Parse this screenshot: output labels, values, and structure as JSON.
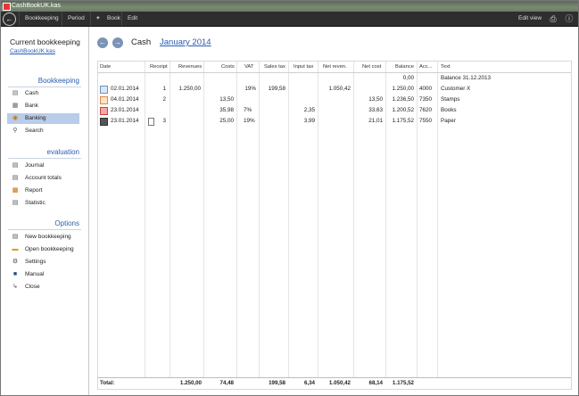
{
  "window": {
    "title": "CashBookUK.kas"
  },
  "toolbar": {
    "items": [
      "Bookkeeping",
      "Period",
      "Book",
      "Edit"
    ],
    "add_glyph": "+",
    "edit_view": "Edit view",
    "icons": [
      "back-icon",
      "printer-icon",
      "info-icon"
    ]
  },
  "sidebar": {
    "title": "Current bookkeeping",
    "file": "CashBookUK.kas",
    "sections": [
      {
        "label": "Bookkeeping",
        "items": [
          {
            "label": "Cash",
            "icon": "cash-icon"
          },
          {
            "label": "Bank",
            "icon": "bank-icon"
          },
          {
            "label": "Banking",
            "icon": "banking-icon",
            "active": true
          },
          {
            "label": "Search",
            "icon": "search-icon"
          }
        ]
      },
      {
        "label": "evaluation",
        "items": [
          {
            "label": "Journal",
            "icon": "journal-icon"
          },
          {
            "label": "Account totals",
            "icon": "account-totals-icon"
          },
          {
            "label": "Report",
            "icon": "report-icon"
          },
          {
            "label": "Statistic",
            "icon": "statistic-icon"
          }
        ]
      },
      {
        "label": "Options",
        "items": [
          {
            "label": "New bookkeeping",
            "icon": "new-icon"
          },
          {
            "label": "Open bookkeeping",
            "icon": "folder-open-icon"
          },
          {
            "label": "Settings",
            "icon": "gear-icon"
          },
          {
            "label": "Manual",
            "icon": "book-icon"
          },
          {
            "label": "Close",
            "icon": "close-icon"
          }
        ]
      }
    ]
  },
  "header": {
    "account": "Cash",
    "period": "January 2014"
  },
  "table": {
    "columns": [
      "Date",
      "Receipt",
      "Revenues",
      "Costs",
      "VAT",
      "Sales tax",
      "Input tax",
      "Net reven.",
      "Net cost",
      "Balance",
      "Acc...",
      "Text"
    ],
    "rows": [
      {
        "date": "",
        "receipt": "",
        "revenues": "",
        "costs": "",
        "vat": "",
        "sales_tax": "",
        "input_tax": "",
        "net_rev": "",
        "net_cost": "",
        "balance": "0,00",
        "acc": "",
        "text": "Balance 31.12.2013",
        "icon": ""
      },
      {
        "date": "02.01.2014",
        "receipt": "1",
        "revenues": "1.250,00",
        "costs": "",
        "vat": "19%",
        "sales_tax": "199,58",
        "input_tax": "",
        "net_rev": "1.050,42",
        "net_cost": "",
        "balance": "1.250,00",
        "acc": "4000",
        "text": "Customer X",
        "icon": "invoice-icon"
      },
      {
        "date": "04.01.2014",
        "receipt": "2",
        "revenues": "",
        "costs": "13,50",
        "vat": "",
        "sales_tax": "",
        "input_tax": "",
        "net_rev": "",
        "net_cost": "13,50",
        "balance": "1.236,50",
        "acc": "7350",
        "text": "Stamps",
        "icon": "stamp-icon"
      },
      {
        "date": "23.01.2014",
        "receipt": "",
        "revenues": "",
        "costs": "35,98",
        "vat": "7%",
        "sales_tax": "",
        "input_tax": "2,35",
        "net_rev": "",
        "net_cost": "33,63",
        "balance": "1.200,52",
        "acc": "7620",
        "text": "Books",
        "icon": "books-icon"
      },
      {
        "date": "23.01.2014",
        "receipt": "3",
        "revenues": "",
        "costs": "25,00",
        "vat": "19%",
        "sales_tax": "",
        "input_tax": "3,99",
        "net_rev": "",
        "net_cost": "21,01",
        "balance": "1.175,52",
        "acc": "7550",
        "text": "Paper",
        "icon": "briefcase-icon"
      }
    ],
    "footer": {
      "label": "Total:",
      "revenues": "1.250,00",
      "costs": "74,48",
      "sales_tax": "199,58",
      "input_tax": "6,34",
      "net_rev": "1.050,42",
      "net_cost": "68,14",
      "balance": "1.175,52"
    }
  }
}
